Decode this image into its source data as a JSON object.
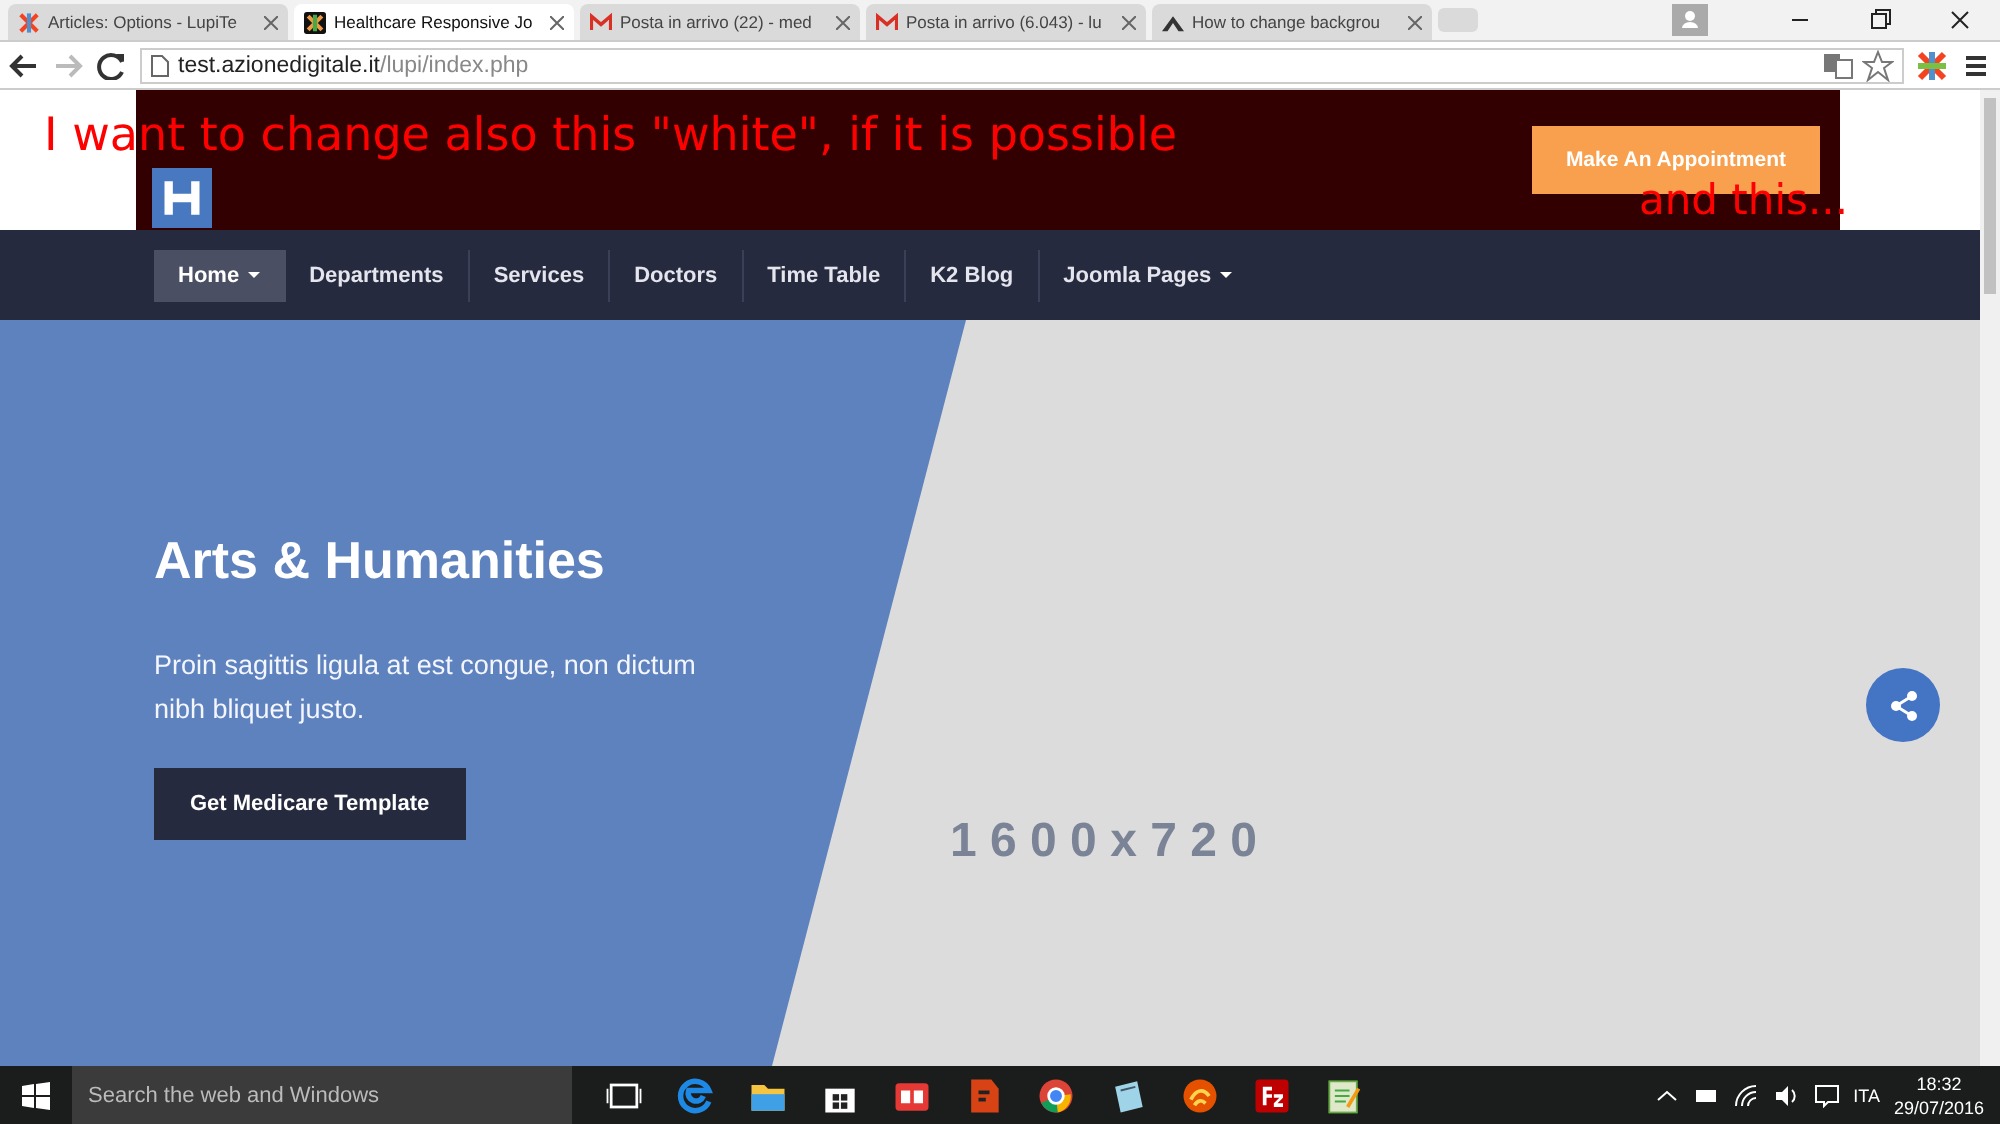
{
  "browser": {
    "tabs": [
      {
        "title": "Articles: Options - LupiTe",
        "selected": false
      },
      {
        "title": "Healthcare Responsive Jo",
        "selected": true
      },
      {
        "title": "Posta in arrivo (22) - med",
        "selected": false
      },
      {
        "title": "Posta in arrivo (6.043) - lu",
        "selected": false
      },
      {
        "title": "How to change backgrou",
        "selected": false
      }
    ],
    "address": {
      "host": "test.azionedigitale.it",
      "path": "/lupi/index.php"
    }
  },
  "site": {
    "header": {
      "button": "Make An Appointment"
    },
    "nav": [
      {
        "label": "Home",
        "selected": true,
        "dropdown": true
      },
      {
        "label": "Departments",
        "selected": false,
        "dropdown": false
      },
      {
        "label": "Services",
        "selected": false,
        "dropdown": false
      },
      {
        "label": "Doctors",
        "selected": false,
        "dropdown": false
      },
      {
        "label": "Time Table",
        "selected": false,
        "dropdown": false
      },
      {
        "label": "K2 Blog",
        "selected": false,
        "dropdown": false
      },
      {
        "label": "Joomla Pages",
        "selected": false,
        "dropdown": true
      }
    ],
    "hero": {
      "title": "Arts & Humanities",
      "text": "Proin sagittis ligula at est congue, non dictum nibh bliquet justo.",
      "button": "Get Medicare Template",
      "placeholder": "1 6 0 0 x 7 2 0"
    }
  },
  "annotations": [
    "I want to change also this \"white\", if it is possible",
    "and this..."
  ],
  "taskbar": {
    "search": {
      "placeholder": "Search the web and Windows"
    },
    "language": "ITA",
    "time": "18:32",
    "date": "29/07/2016"
  }
}
